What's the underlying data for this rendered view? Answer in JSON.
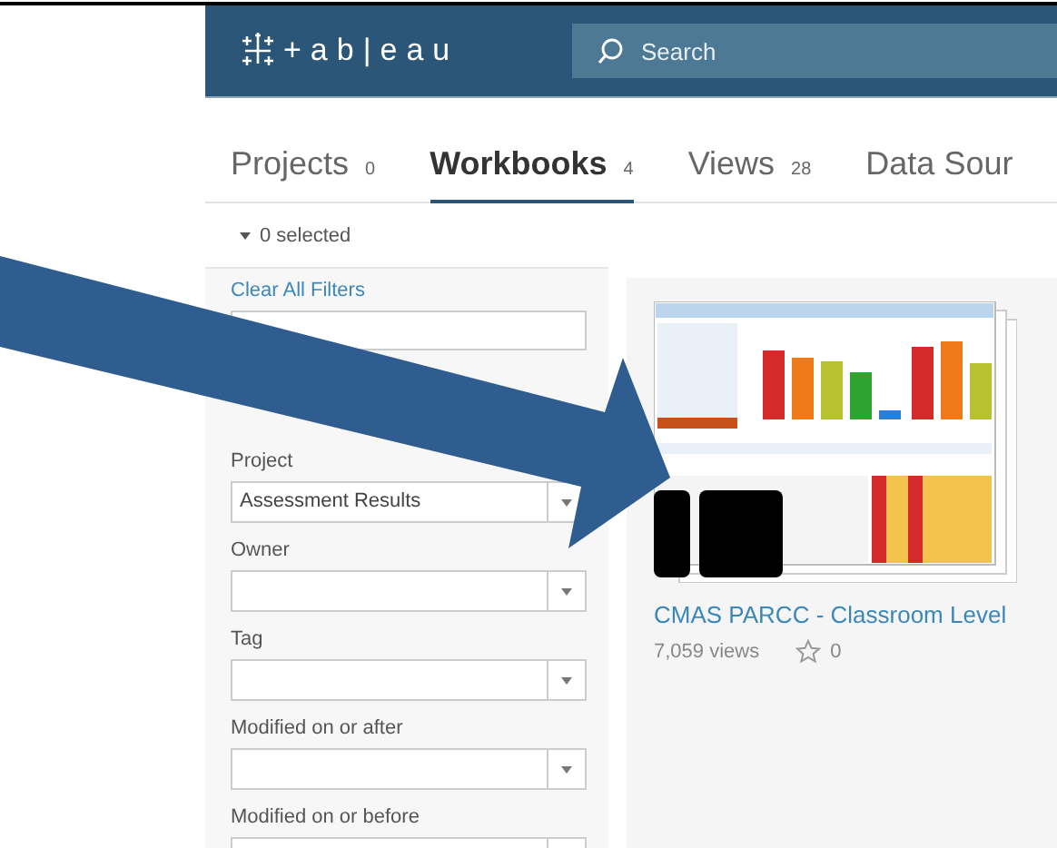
{
  "header": {
    "logo_text": "+ab|eau",
    "search": {
      "placeholder": "Search"
    }
  },
  "tabs": [
    {
      "label": "Projects",
      "count": "0",
      "selected": false
    },
    {
      "label": "Workbooks",
      "count": "4",
      "selected": true
    },
    {
      "label": "Views",
      "count": "28",
      "selected": false
    },
    {
      "label": "Data Sour",
      "selected": false
    }
  ],
  "selection": {
    "text": "0 selected"
  },
  "filters": {
    "clear_link": "Clear All Filters",
    "fields": [
      {
        "label": "Project",
        "value": "Assessment Results"
      },
      {
        "label": "Owner"
      },
      {
        "label": "Tag"
      },
      {
        "label": "Modified on or after"
      },
      {
        "label": "Modified on or before"
      }
    ]
  },
  "workbooks": [
    {
      "title": "CMAS PARCC - Classroom Level",
      "views": "7,059 views",
      "favorites": "0",
      "redacted": true
    }
  ]
}
